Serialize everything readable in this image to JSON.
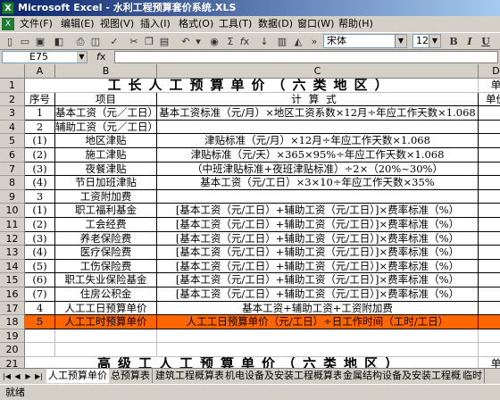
{
  "window": {
    "title": "Microsoft Excel - 水利工程预算套价系统.XLS"
  },
  "menu": [
    "文件(F)",
    "编辑(E)",
    "视图(V)",
    "插入(I)",
    "格式(O)",
    "工具(T)",
    "数据(D)",
    "窗口(W)",
    "帮助(H)"
  ],
  "toolbar": {
    "font": "宋体",
    "size": "12",
    "bold": "B",
    "italic": "I",
    "underline": "U"
  },
  "formula_bar": {
    "cell_ref": "E75",
    "content": ""
  },
  "columns": [
    "A",
    "B",
    "C",
    "D"
  ],
  "row_numbers": [
    "1",
    "2",
    "3",
    "4",
    "5",
    "6",
    "7",
    "8",
    "9",
    "10",
    "11",
    "12",
    "13",
    "14",
    "15",
    "16",
    "17",
    "18",
    "19",
    "20",
    "21",
    "22"
  ],
  "sheet": {
    "title1": "工长人工预算单价（六类地区）",
    "title1_right": "单",
    "headers": {
      "a": "序号",
      "b": "项目",
      "c": "计算式",
      "d": "单价"
    },
    "rows": [
      {
        "a": "1",
        "b": "基本工资（元／工日）",
        "c": "基本工资标准（元/月）×地区工资系数×12月÷年应工作天数×1.068"
      },
      {
        "a": "2",
        "b": "辅助工资（元／工日）",
        "c": ""
      },
      {
        "a": "(1)",
        "b": "地区津贴",
        "c": "津贴标准（元/月）×12月÷年应工作天数×1.068"
      },
      {
        "a": "(2)",
        "b": "施工津贴",
        "c": "津贴标准（元/天）×365×95%÷年应工作天数×1.068"
      },
      {
        "a": "(3)",
        "b": "夜餐津贴",
        "c": "（中班津贴标准+夜班津贴标准）÷2×（20%~30%）"
      },
      {
        "a": "(4)",
        "b": "节日加班津贴",
        "c": "基本工资（元/工日）×3×10÷年应工作天数×35%"
      },
      {
        "a": "3",
        "b": "工资附加费",
        "c": ""
      },
      {
        "a": "(1)",
        "b": "职工福利基金",
        "c": "[基本工资（元/工日）+辅助工资（元/工日）]×费率标准（%）"
      },
      {
        "a": "(2)",
        "b": "工会经费",
        "c": "[基本工资（元/工日）+辅助工资（元/工日）]×费率标准（%）"
      },
      {
        "a": "(3)",
        "b": "养老保险费",
        "c": "[基本工资（元/工日）+辅助工资（元/工日）]×费率标准（%）"
      },
      {
        "a": "(4)",
        "b": "医疗保险费",
        "c": "[基本工资（元/工日）+辅助工资（元/工日）]×费率标准（%）"
      },
      {
        "a": "(5)",
        "b": "工伤保险费",
        "c": "[基本工资（元/工日）+辅助工资（元/工日）]×费率标准（%）"
      },
      {
        "a": "(6)",
        "b": "职工失业保险基金",
        "c": "[基本工资（元/工日）+辅助工资（元/工日）]×费率标准（%）"
      },
      {
        "a": "(7)",
        "b": "住房公积金",
        "c": "[基本工资（元/工日）+辅助工资（元/工日）]×费率标准（%）"
      },
      {
        "a": "4",
        "b": "人工工日预算单价",
        "c": "基本工资+辅助工资+工资附加费"
      },
      {
        "a": "5",
        "b": "人工工时预算单价",
        "c": "人工工日预算单价（元/工日）÷日工作时间（工时/工日）"
      }
    ],
    "title2": "高级工人工预算单价（六类地区）",
    "title2_right": "单",
    "headers2": {
      "a": "序号",
      "b": "项目",
      "c": "计算式",
      "d": "单价"
    }
  },
  "tabs": [
    "人工预算单价",
    "总预算表",
    "建筑工程概算表",
    "机电设备及安装工程概算表",
    "金属结构设备及安装工程概算表",
    "临时"
  ],
  "status": "就绪"
}
